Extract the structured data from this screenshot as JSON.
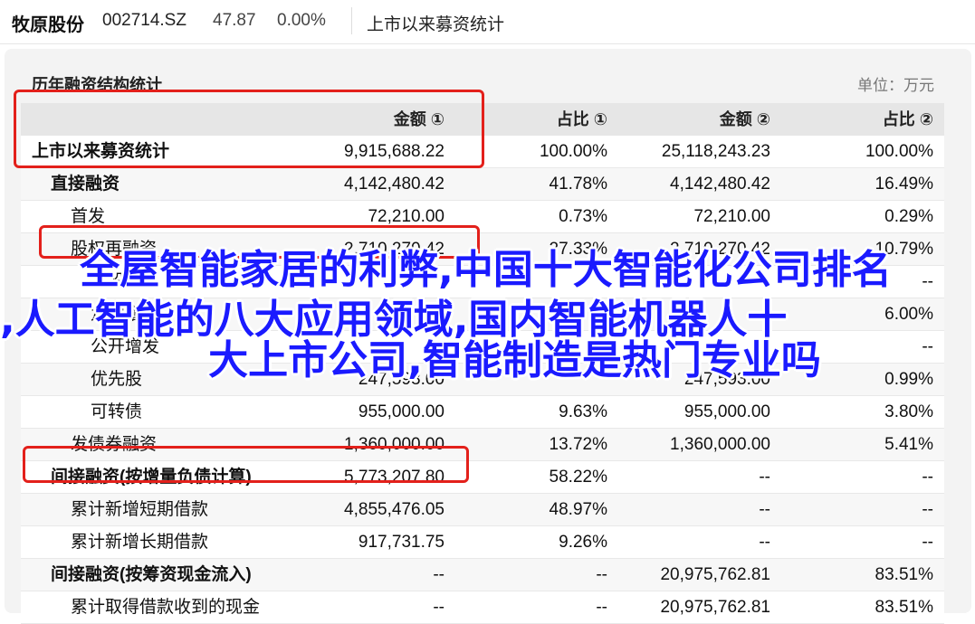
{
  "header": {
    "stock_name": "牧原股份",
    "stock_code": "002714.SZ",
    "price": "47.87",
    "change": "0.00%",
    "tab": "上市以来募资统计"
  },
  "panel": {
    "title": "历年融资结构统计",
    "unit": "单位：万元"
  },
  "table": {
    "columns": [
      "",
      "金额 ①",
      "占比 ①",
      "金额 ②",
      "占比 ②"
    ],
    "rows": [
      {
        "label": "上市以来募资统计",
        "level": 0,
        "amount1": "9,915,688.22",
        "pct1": "100.00%",
        "amount2": "25,118,243.23",
        "pct2": "100.00%"
      },
      {
        "label": "直接融资",
        "level": 1,
        "amount1": "4,142,480.42",
        "pct1": "41.78%",
        "amount2": "4,142,480.42",
        "pct2": "16.49%"
      },
      {
        "label": "首发",
        "level": 2,
        "amount1": "72,210.00",
        "pct1": "0.73%",
        "amount2": "72,210.00",
        "pct2": "0.29%"
      },
      {
        "label": "股权再融资",
        "level": 2,
        "amount1": "2,710,270.42",
        "pct1": "27.33%",
        "amount2": "2,710,270.42",
        "pct2": "10.79%"
      },
      {
        "label": "配股",
        "level": 3,
        "amount1": "",
        "pct1": "",
        "amount2": "",
        "pct2": "--"
      },
      {
        "label": "定向增发",
        "level": 3,
        "amount1": "",
        "pct1": "",
        "amount2": "",
        "pct2": "6.00%"
      },
      {
        "label": "公开增发",
        "level": 3,
        "amount1": "",
        "pct1": "",
        "amount2": "",
        "pct2": "--"
      },
      {
        "label": "优先股",
        "level": 3,
        "amount1": "247,593.00",
        "pct1": "",
        "amount2": "247,593.00",
        "pct2": "0.99%"
      },
      {
        "label": "可转债",
        "level": 3,
        "amount1": "955,000.00",
        "pct1": "9.63%",
        "amount2": "955,000.00",
        "pct2": "3.80%"
      },
      {
        "label": "发债券融资",
        "level": 2,
        "amount1": "1,360,000.00",
        "pct1": "13.72%",
        "amount2": "1,360,000.00",
        "pct2": "5.41%"
      },
      {
        "label": "间接融资(按增量负债计算)",
        "level": 1,
        "amount1": "5,773,207.80",
        "pct1": "58.22%",
        "amount2": "--",
        "pct2": "--"
      },
      {
        "label": "累计新增短期借款",
        "level": 2,
        "amount1": "4,855,476.05",
        "pct1": "48.97%",
        "amount2": "--",
        "pct2": "--"
      },
      {
        "label": "累计新增长期借款",
        "level": 2,
        "amount1": "917,731.75",
        "pct1": "9.26%",
        "amount2": "--",
        "pct2": "--"
      },
      {
        "label": "间接融资(按筹资现金流入)",
        "level": 1,
        "amount1": "--",
        "pct1": "--",
        "amount2": "20,975,762.81",
        "pct2": "83.51%"
      },
      {
        "label": "累计取得借款收到的现金",
        "level": 2,
        "amount1": "--",
        "pct1": "--",
        "amount2": "20,975,762.81",
        "pct2": "83.51%"
      }
    ]
  },
  "overlay": {
    "line1": "全屋智能家居的利弊,中国十大智能化公司排名",
    "line2": ",人工智能的八大应用领域,国内智能机器人十",
    "line3": "大上市公司,智能制造是热门专业吗"
  },
  "colors": {
    "highlight_box": "#e3201b",
    "overlay_text": "#1a1aff"
  }
}
